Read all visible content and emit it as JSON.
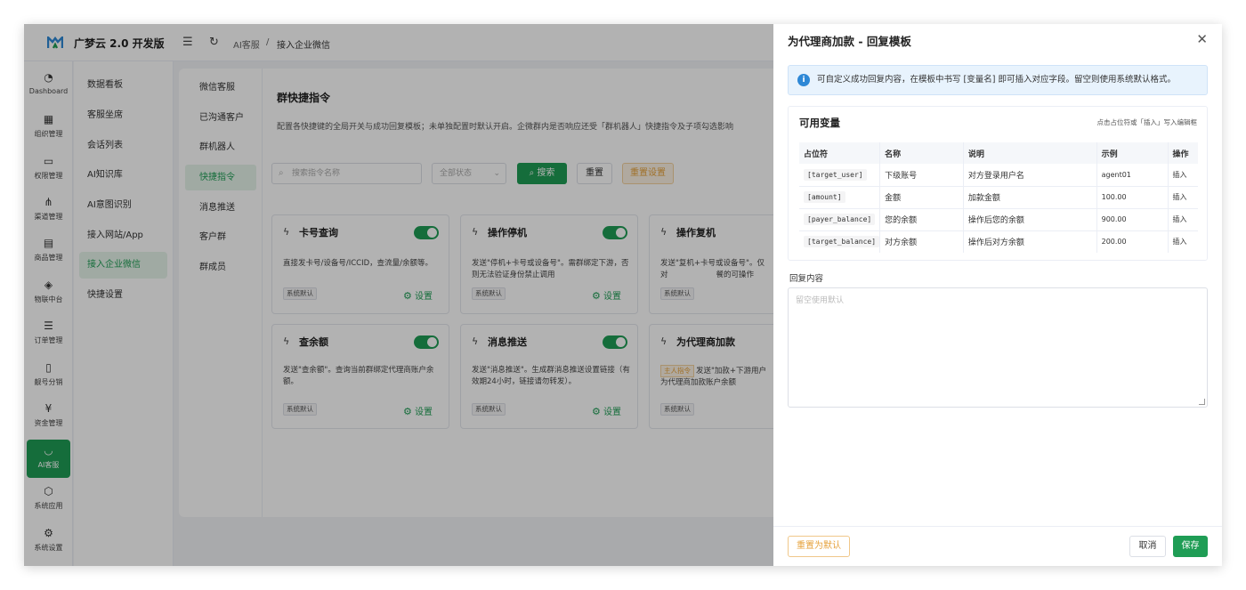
{
  "brand": "广梦云 2.0 开发版",
  "breadcrumb": [
    "AI客服",
    "接入企业微信"
  ],
  "nav": [
    {
      "label": "Dashboard",
      "icon": "dashboard-icon",
      "glyph": "◔"
    },
    {
      "label": "组织管理",
      "icon": "grid-icon",
      "glyph": "▦"
    },
    {
      "label": "权限管理",
      "icon": "monitor-icon",
      "glyph": "▭"
    },
    {
      "label": "渠道管理",
      "icon": "branch-icon",
      "glyph": "⋔"
    },
    {
      "label": "商品管理",
      "icon": "store-icon",
      "glyph": "▤"
    },
    {
      "label": "物联中台",
      "icon": "iot-icon",
      "glyph": "◈"
    },
    {
      "label": "订单管理",
      "icon": "list-icon",
      "glyph": "☰"
    },
    {
      "label": "靓号分销",
      "icon": "phone-icon",
      "glyph": "▯"
    },
    {
      "label": "资金管理",
      "icon": "yuan-icon",
      "glyph": "¥"
    },
    {
      "label": "AI客服",
      "icon": "ai-service-icon",
      "glyph": "◡"
    },
    {
      "label": "系统应用",
      "icon": "cube-icon",
      "glyph": "⬡"
    },
    {
      "label": "系统设置",
      "icon": "settings-icon",
      "glyph": "⚙"
    }
  ],
  "sub1": [
    "数据看板",
    "客服坐席",
    "会话列表",
    "AI知识库",
    "AI意图识别",
    "接入网站/App",
    "接入企业微信",
    "快捷设置"
  ],
  "sub2": [
    "微信客服",
    "已沟通客户",
    "群机器人",
    "快捷指令",
    "消息推送",
    "客户群",
    "群成员"
  ],
  "page": {
    "title": "群快捷指令",
    "desc": "配置各快捷键的全局开关与成功回复模板；未单独配置时默认开启。企微群内是否响应还受「群机器人」快捷指令及子项勾选影响",
    "search_placeholder": "搜索指令名称",
    "status_placeholder": "全部状态",
    "search_btn": "搜索",
    "reset_btn": "重置",
    "reset_settings_btn": "重置设置"
  },
  "cards": [
    {
      "title": "卡号查询",
      "desc": "直接发卡号/设备号/ICCID，查流量/余额等。",
      "tag": "系统默认",
      "settings": "设置"
    },
    {
      "title": "操作停机",
      "desc": "发送\"停机+卡号或设备号\"。需群绑定下游，否则无法验证身份禁止调用",
      "tag": "系统默认",
      "settings": "设置"
    },
    {
      "title": "操作复机",
      "desc": "发送\"复机+卡号或设备号\"。仅对                    餐的可操作",
      "tag": "系统默认",
      "settings": "设置"
    },
    {
      "title": "查余额",
      "desc": "发送\"查余额\"。查询当前群绑定代理商账户余额。",
      "tag": "系统默认",
      "settings": "设置"
    },
    {
      "title": "消息推送",
      "desc": "发送\"消息推送\"。生成群消息推送设置链接（有效期24小时，链接请勿转发）。",
      "tag": "系统默认",
      "settings": "设置"
    },
    {
      "title": "为代理商加款",
      "main_tag": "主人指令",
      "desc_line1": "发送\"加款+下游用户",
      "desc_line2": "为代理商加款账户余额",
      "tag": "系统默认"
    }
  ],
  "drawer": {
    "title": "为代理商加款 - 回复模板",
    "info_text": "可自定义成功回复内容，在模板中书写 [变量名] 即可插入对应字段。留空则使用系统默认格式。",
    "vars_title": "可用变量",
    "vars_hint": "点击占位符或「插入」写入编辑框",
    "columns": [
      "占位符",
      "名称",
      "说明",
      "示例",
      "操作"
    ],
    "rows": [
      {
        "ph": "[target_user]",
        "name": "下级账号",
        "desc": "对方登录用户名",
        "example": "agent01",
        "action": "插入"
      },
      {
        "ph": "[amount]",
        "name": "金额",
        "desc": "加款金额",
        "example": "100.00",
        "action": "插入"
      },
      {
        "ph": "[payer_balance]",
        "name": "您的余额",
        "desc": "操作后您的余额",
        "example": "900.00",
        "action": "插入"
      },
      {
        "ph": "[target_balance]",
        "name": "对方余额",
        "desc": "操作后对方余额",
        "example": "200.00",
        "action": "插入"
      }
    ],
    "reply_label": "回复内容",
    "reply_placeholder": "留空使用默认",
    "reset_default_btn": "重置为默认",
    "cancel_btn": "取消",
    "save_btn": "保存"
  },
  "colors": {
    "primary": "#1f9d55",
    "warning": "#e6a23c",
    "info": "#2e88d6"
  }
}
